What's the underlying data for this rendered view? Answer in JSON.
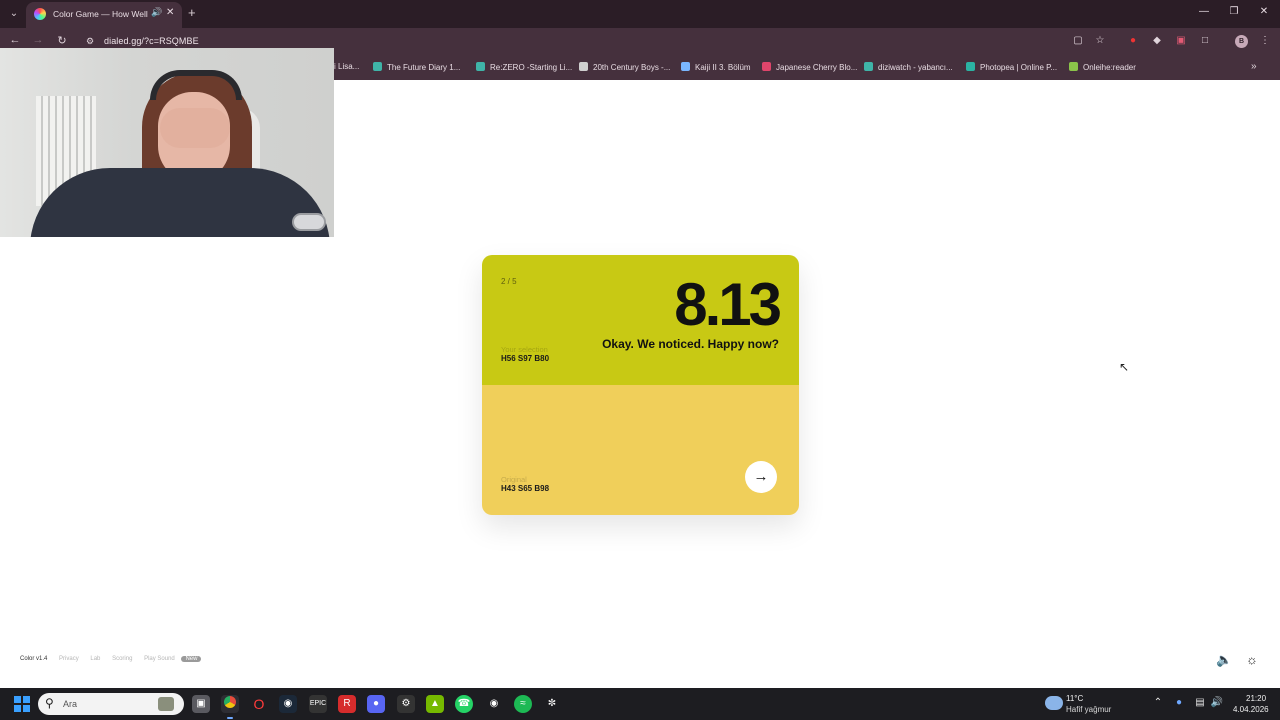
{
  "browser": {
    "tab_title": "Color Game — How Well C",
    "new_tab": "+",
    "url": "dialed.gg/?c=RSQMBE",
    "profile_initial": "B",
    "bookmarks": [
      {
        "label": "i Lisa...",
        "color": "#d9d9d9"
      },
      {
        "label": "The Future Diary 1...",
        "color": "#3fb4a8"
      },
      {
        "label": "Re:ZERO -Starting Li...",
        "color": "#3fb4a8"
      },
      {
        "label": "20th Century Boys -...",
        "color": "#cfcfcf"
      },
      {
        "label": "Kaiji II 3. Bölüm",
        "color": "#7ab6ff"
      },
      {
        "label": "Japanese Cherry Blo...",
        "color": "#e0456b"
      },
      {
        "label": "diziwatch - yabancı...",
        "color": "#3fb4a8"
      },
      {
        "label": "Photopea | Online P...",
        "color": "#2bb3a3"
      },
      {
        "label": "Onleihe:reader",
        "color": "#8bc34a"
      }
    ]
  },
  "game": {
    "round": "2 / 5",
    "score": "8.13",
    "comment": "Okay. We noticed. Happy now?",
    "selection_label": "Your selection",
    "selection_value": "H56 S97 B80",
    "original_label": "Original",
    "original_value": "H43 S65 B98",
    "selection_color": "#c8c914",
    "original_color": "#f0cf5a",
    "next_icon": "arrow-right-icon"
  },
  "footer": {
    "brand": "Color v1.4",
    "links": [
      "Privacy",
      "Lab",
      "Scoring",
      "Play Sound"
    ],
    "badge": "New"
  },
  "taskbar": {
    "search_placeholder": "Ara",
    "weather_temp": "11°C",
    "weather_desc": "Hafif yağmur",
    "time": "21:20",
    "date": "4.04.2026"
  }
}
